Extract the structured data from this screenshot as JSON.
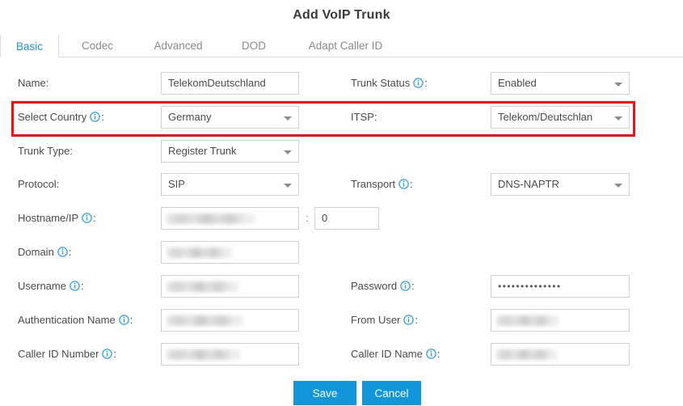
{
  "dialog": {
    "title": "Add VoIP Trunk"
  },
  "tabs": [
    {
      "label": "Basic",
      "active": true
    },
    {
      "label": "Codec",
      "active": false
    },
    {
      "label": "Advanced",
      "active": false
    },
    {
      "label": "DOD",
      "active": false
    },
    {
      "label": "Adapt Caller ID",
      "active": false
    }
  ],
  "form": {
    "name": {
      "label": "Name",
      "value": "TelekomDeutschland",
      "has_info": false
    },
    "trunk_status": {
      "label": "Trunk Status",
      "value": "Enabled",
      "has_info": true
    },
    "select_country": {
      "label": "Select Country",
      "value": "Germany",
      "has_info": true
    },
    "itsp": {
      "label": "ITSP",
      "value": "Telekom/Deutschlan",
      "has_info": false
    },
    "trunk_type": {
      "label": "Trunk Type",
      "value": "Register Trunk",
      "has_info": false
    },
    "protocol": {
      "label": "Protocol",
      "value": "SIP",
      "has_info": false
    },
    "transport": {
      "label": "Transport",
      "value": "DNS-NAPTR",
      "has_info": true
    },
    "hostname_ip": {
      "label": "Hostname/IP",
      "value": "",
      "redacted": true,
      "has_info": true,
      "separator": ":"
    },
    "port": {
      "value": "0"
    },
    "domain": {
      "label": "Domain",
      "value": "",
      "redacted": true,
      "has_info": true
    },
    "username": {
      "label": "Username",
      "value": "",
      "redacted": true,
      "has_info": true
    },
    "password": {
      "label": "Password",
      "value": "••••••••••••••",
      "has_info": true
    },
    "authentication_name": {
      "label": "Authentication Name",
      "value": "",
      "redacted": true,
      "has_info": true
    },
    "from_user": {
      "label": "From User",
      "value": "",
      "redacted": true,
      "has_info": true
    },
    "caller_id_number": {
      "label": "Caller ID Number",
      "value": "",
      "redacted": true,
      "has_info": true
    },
    "caller_id_name": {
      "label": "Caller ID Name",
      "value": "",
      "redacted": true,
      "has_info": true
    }
  },
  "actions": {
    "save_label": "Save",
    "cancel_label": "Cancel"
  },
  "highlight": {
    "color": "#fb0d0d",
    "targets": [
      "select_country",
      "itsp"
    ]
  },
  "colors": {
    "accent_blue": "#1296db",
    "tab_active": "#1b92e0",
    "info_icon": "#29a6e0",
    "border": "#cfcfcf",
    "highlight_red": "#fb0d0d"
  },
  "icons": {
    "info": "info-icon",
    "dropdown": "chevron-down-icon"
  }
}
